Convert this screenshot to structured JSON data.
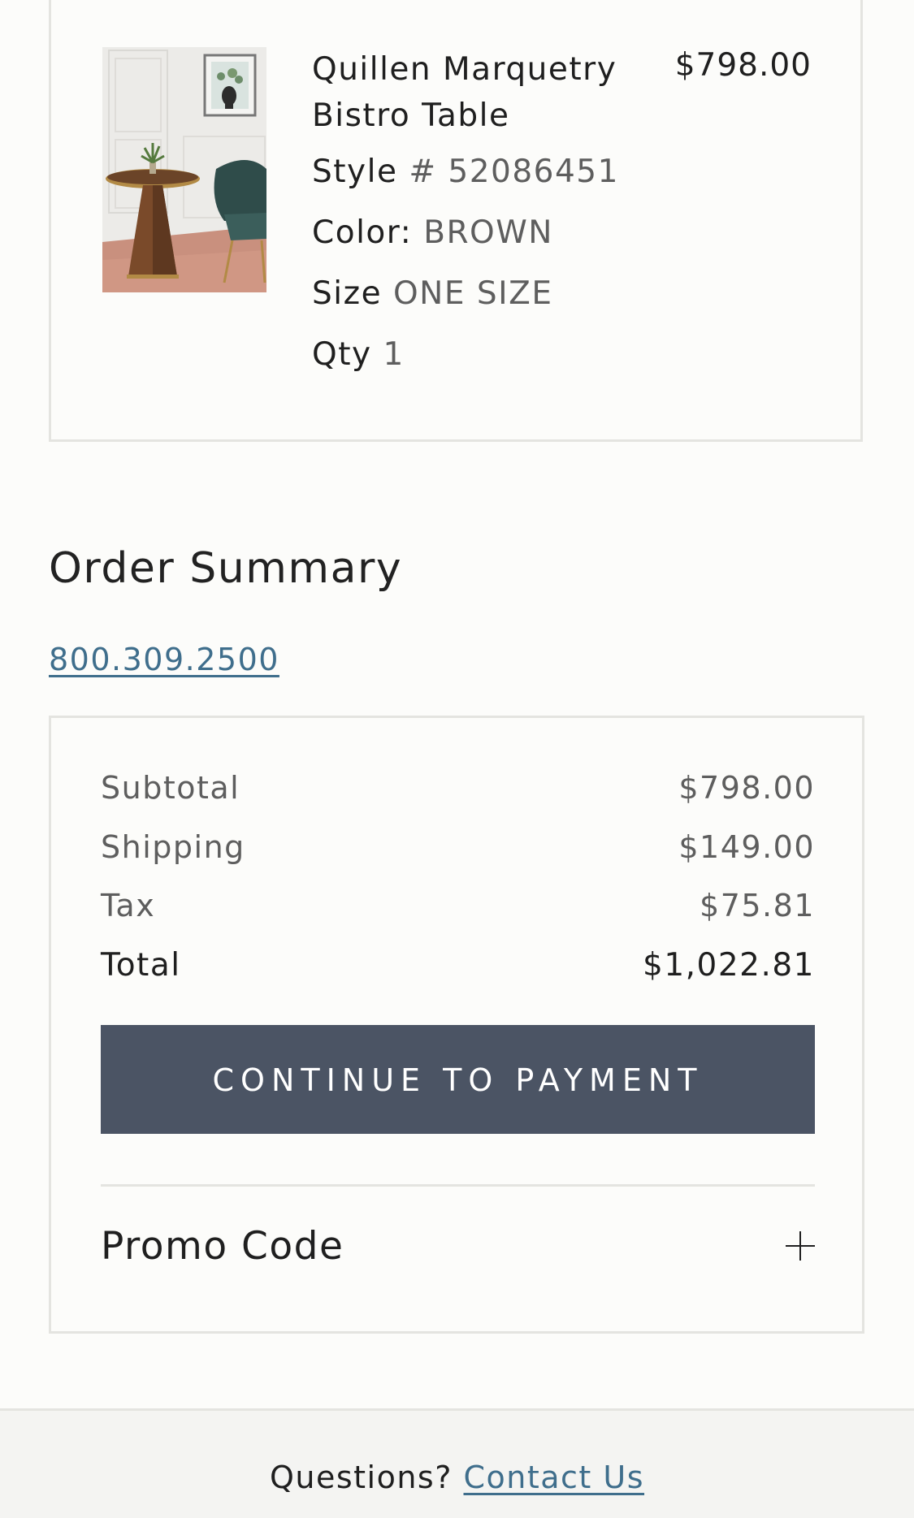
{
  "item": {
    "name": "Quillen Marquetry Bistro Table",
    "price": "$798.00",
    "style_label": "Style",
    "style_value": "# 52086451",
    "color_label": "Color:",
    "color_value": "BROWN",
    "size_label": "Size",
    "size_value": "ONE SIZE",
    "qty_label": "Qty",
    "qty_value": "1"
  },
  "summary": {
    "title": "Order Summary",
    "phone": "800.309.2500"
  },
  "totals": {
    "rows": [
      {
        "label": "Subtotal",
        "value": "$798.00"
      },
      {
        "label": "Shipping",
        "value": "$149.00"
      },
      {
        "label": "Tax",
        "value": "$75.81"
      }
    ],
    "total_label": "Total",
    "total_value": "$1,022.81",
    "continue_label": "CONTINUE TO PAYMENT",
    "promo_label": "Promo Code",
    "button_color": "#4b5464"
  },
  "footer": {
    "question": "Questions?",
    "contact_label": "Contact Us",
    "link_color": "#3f6e8c"
  }
}
